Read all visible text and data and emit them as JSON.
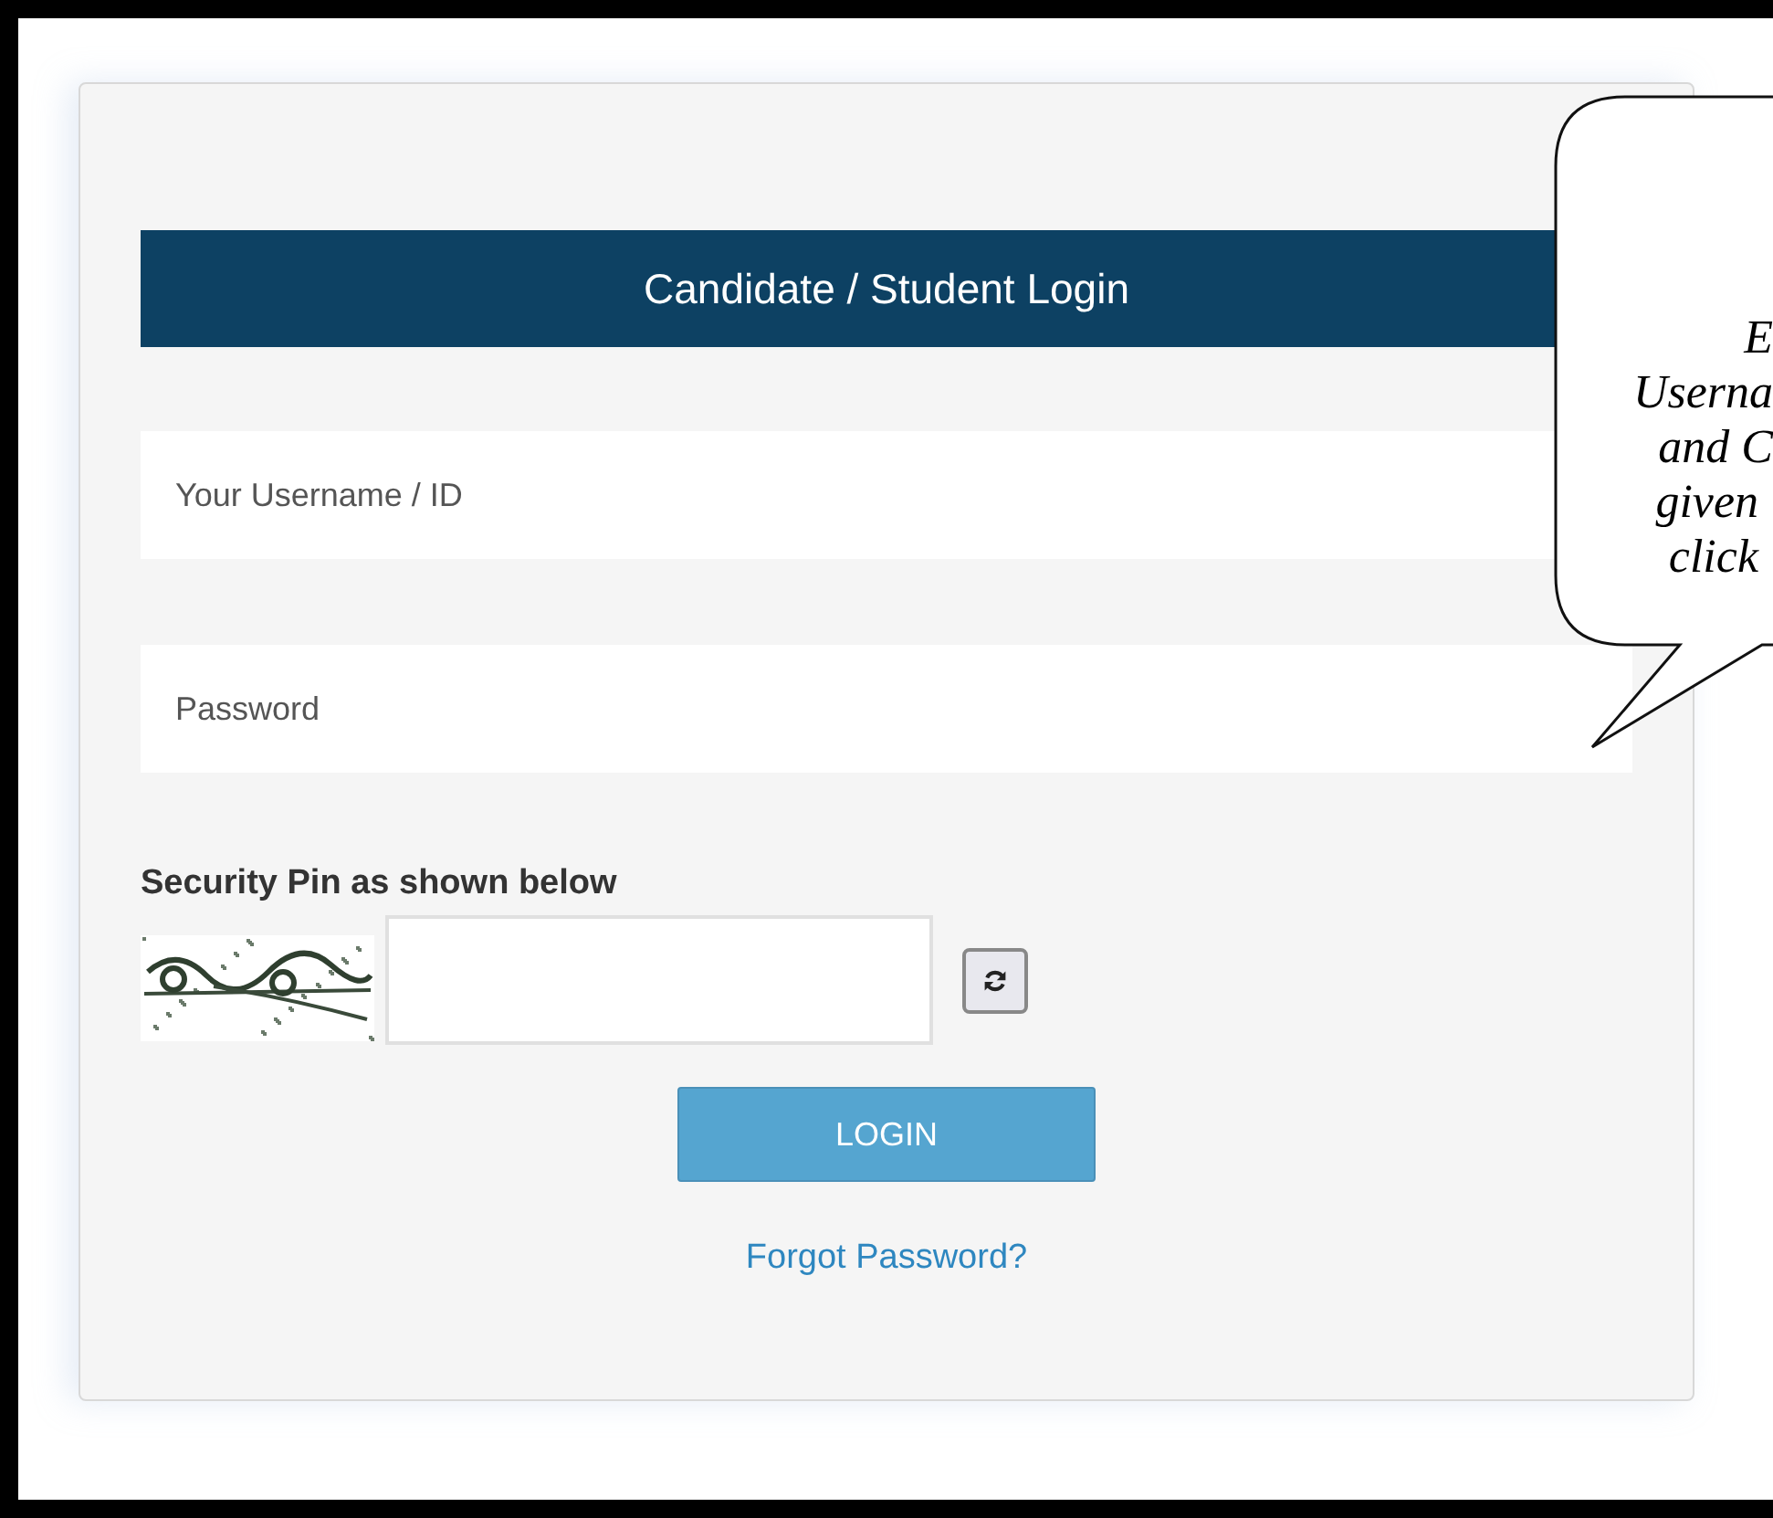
{
  "login": {
    "title": "Candidate / Student Login",
    "fields": [
      {
        "placeholder": "Your Username / ID"
      },
      {
        "placeholder": "Password"
      }
    ],
    "security_label": "Security Pin as shown below",
    "button": "LOGIN",
    "link": "Forgot Password?"
  },
  "callout": {
    "lines": [
      "E",
      "Userna",
      "and C",
      "given",
      "click"
    ]
  }
}
